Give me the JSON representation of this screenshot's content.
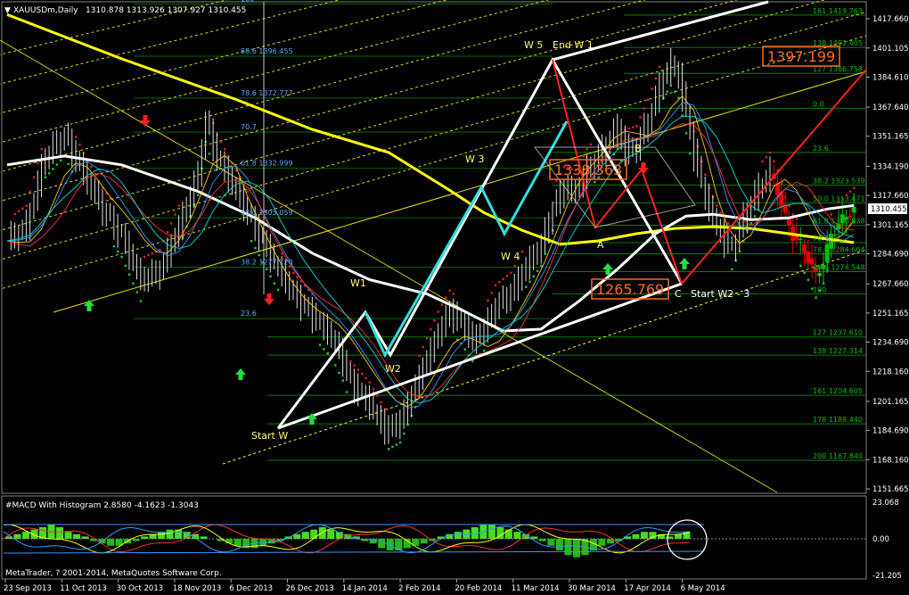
{
  "header": {
    "symbol": "XAUUSDm,Daily",
    "ohlc": "1310.878 1313.926 1307.927 1310.455"
  },
  "colors": {
    "background": "#000000",
    "bull_candle": "#00c000",
    "bear_candle": "#e00000",
    "ma_yellow": "#ffff00",
    "ma_white": "#ffffff",
    "fib_lines": "#008000",
    "fib_text": "#00c000",
    "channel": "#ffff00",
    "wave_cyan": "#33dddd",
    "red_projection": "#ff2020",
    "callout": "#ff6a1a"
  },
  "chart_data": [
    {
      "type": "line",
      "title": "",
      "xlabel": "",
      "ylabel": "",
      "x_ticks": [
        "23 Sep 2013",
        "11 Oct 2013",
        "30 Oct 2013",
        "18 Nov 2013",
        "6 Dec 2013",
        "26 Dec 2013",
        "14 Jan 2014",
        "2 Feb 2014",
        "20 Feb 2014",
        "11 Mar 2014",
        "30 Mar 2014",
        "17 Apr 2014",
        "6 May 2014"
      ],
      "y_ticks": [
        "1417.660",
        "1401.105",
        "1384.610",
        "1367.640",
        "1351.165",
        "1334.190",
        "1317.660",
        "1301.165",
        "1284.690",
        "1267.660",
        "1251.165",
        "1234.690",
        "1218.160",
        "1201.165",
        "1184.690",
        "1168.160",
        "1151.665"
      ],
      "ylim": [
        1151.665,
        1426
      ],
      "current_price": "1310.455",
      "price_path": [
        [
          0,
          1292
        ],
        [
          5,
          1300
        ],
        [
          10,
          1340
        ],
        [
          15,
          1352
        ],
        [
          20,
          1330
        ],
        [
          25,
          1310
        ],
        [
          30,
          1295
        ],
        [
          35,
          1270
        ],
        [
          40,
          1275
        ],
        [
          45,
          1300
        ],
        [
          50,
          1330
        ],
        [
          52,
          1360
        ],
        [
          55,
          1340
        ],
        [
          60,
          1320
        ],
        [
          65,
          1300
        ],
        [
          70,
          1280
        ],
        [
          75,
          1262
        ],
        [
          80,
          1250
        ],
        [
          85,
          1238
        ],
        [
          88,
          1225
        ],
        [
          90,
          1212
        ],
        [
          95,
          1200
        ],
        [
          99,
          1185
        ],
        [
          103,
          1190
        ],
        [
          107,
          1210
        ],
        [
          110,
          1225
        ],
        [
          113,
          1240
        ],
        [
          116,
          1252
        ],
        [
          119,
          1246
        ],
        [
          122,
          1236
        ],
        [
          125,
          1242
        ],
        [
          128,
          1255
        ],
        [
          132,
          1262
        ],
        [
          136,
          1278
        ],
        [
          140,
          1290
        ],
        [
          143,
          1310
        ],
        [
          146,
          1322
        ],
        [
          149,
          1320
        ],
        [
          152,
          1332
        ],
        [
          155,
          1340
        ],
        [
          158,
          1350
        ],
        [
          160,
          1356
        ],
        [
          162,
          1343
        ],
        [
          165,
          1345
        ],
        [
          168,
          1360
        ],
        [
          170,
          1372
        ],
        [
          172,
          1385
        ],
        [
          174,
          1392
        ],
        [
          176,
          1385
        ],
        [
          178,
          1365
        ],
        [
          180,
          1342
        ],
        [
          182,
          1325
        ],
        [
          184,
          1310
        ],
        [
          186,
          1300
        ],
        [
          188,
          1292
        ],
        [
          190,
          1288
        ],
        [
          192,
          1298
        ],
        [
          194,
          1310
        ],
        [
          196,
          1318
        ],
        [
          198,
          1325
        ],
        [
          200,
          1330
        ],
        [
          202,
          1320
        ],
        [
          204,
          1305
        ],
        [
          206,
          1295
        ],
        [
          208,
          1290
        ],
        [
          210,
          1282
        ],
        [
          212,
          1272
        ],
        [
          214,
          1280
        ],
        [
          216,
          1295
        ],
        [
          218,
          1302
        ],
        [
          220,
          1306
        ],
        [
          222,
          1310
        ]
      ],
      "series": [
        {
          "name": "",
          "color": "#ffff00",
          "values": [
            [
              0,
              1420
            ],
            [
              30,
              1395
            ],
            [
              60,
              1372
            ],
            [
              80,
              1355
            ],
            [
              100,
              1342
            ],
            [
              115,
              1322
            ],
            [
              125,
              1308
            ],
            [
              135,
              1298
            ],
            [
              145,
              1290
            ],
            [
              155,
              1292
            ],
            [
              165,
              1296
            ],
            [
              175,
              1299
            ],
            [
              185,
              1300
            ],
            [
              195,
              1299
            ],
            [
              205,
              1296
            ],
            [
              215,
              1293
            ],
            [
              222,
              1291
            ]
          ]
        },
        {
          "name": "",
          "color": "#ffffff",
          "values": [
            [
              0,
              1335
            ],
            [
              15,
              1340
            ],
            [
              30,
              1335
            ],
            [
              50,
              1320
            ],
            [
              65,
              1305
            ],
            [
              80,
              1285
            ],
            [
              95,
              1270
            ],
            [
              110,
              1262
            ],
            [
              120,
              1252
            ],
            [
              130,
              1241
            ],
            [
              140,
              1242
            ],
            [
              150,
              1258
            ],
            [
              160,
              1276
            ],
            [
              170,
              1296
            ],
            [
              178,
              1306
            ],
            [
              185,
              1307
            ],
            [
              195,
              1304
            ],
            [
              205,
              1305
            ],
            [
              215,
              1310
            ],
            [
              222,
              1312
            ]
          ]
        }
      ],
      "fibonacci_upper": [
        {
          "level": "161",
          "price": "1419.763"
        },
        {
          "level": "138",
          "price": "1401.405"
        },
        {
          "level": "127",
          "price": "1386.758"
        },
        {
          "level": "0.0",
          "price": ""
        },
        {
          "level": "23.6",
          "price": ""
        },
        {
          "level": "38.2",
          "price": "1323.539"
        },
        {
          "level": "50.0",
          "price": "1313.471"
        },
        {
          "level": "61.8",
          "price": "1300.838"
        },
        {
          "level": "70.7",
          "price": ""
        },
        {
          "level": "78.6",
          "price": "1284.664"
        },
        {
          "level": "88.6",
          "price": "1274.548"
        },
        {
          "level": "100",
          "price": ""
        },
        {
          "level": "127",
          "price": "1237.610"
        },
        {
          "level": "138",
          "price": "1227.314"
        },
        {
          "level": "161",
          "price": "1204.605"
        },
        {
          "level": "178",
          "price": "1188.440"
        },
        {
          "level": "200",
          "price": "1167.840"
        }
      ],
      "fibonacci_left": [
        {
          "level": "100",
          "price": ""
        },
        {
          "level": "88.6",
          "price": "1396.455"
        },
        {
          "level": "78.6",
          "price": "1372.777"
        },
        {
          "level": "70.7",
          "price": ""
        },
        {
          "level": "61.8",
          "price": "1332.999"
        },
        {
          "level": "50.0",
          "price": "1305.059"
        },
        {
          "level": "38.2",
          "price": "1277.120"
        },
        {
          "level": "23.6",
          "price": ""
        }
      ],
      "wave_labels": [
        "W 5",
        "End W 1",
        "W 3",
        "W 4",
        "W1",
        "W2",
        "Start W",
        "A",
        "B",
        "C",
        "Start W2 - 3"
      ],
      "callouts": [
        "1397.199",
        "1338.363",
        "1265.769"
      ]
    },
    {
      "type": "bar",
      "title": "#MACD With Histogram 2.8580 -4.1623 -1.3043",
      "y_ticks": [
        "23.068",
        "0.00",
        "-21.205"
      ],
      "ylim": [
        -21.205,
        23.068
      ],
      "histogram": [
        1,
        2,
        3,
        4,
        5,
        6,
        5,
        3,
        2,
        1,
        -1,
        -2,
        -3,
        -3,
        -2,
        -1,
        1,
        2,
        3,
        4,
        4,
        3,
        2,
        1,
        0,
        -1,
        -2,
        -3,
        -4,
        -4,
        -3,
        -2,
        -1,
        1,
        2,
        3,
        4,
        5,
        4,
        3,
        2,
        1,
        -1,
        -2,
        -4,
        -5,
        -5,
        -4,
        -3,
        -2,
        -1,
        1,
        2,
        3,
        4,
        5,
        6,
        6,
        5,
        4,
        3,
        2,
        1,
        -1,
        -3,
        -5,
        -7,
        -8,
        -7,
        -5,
        -3,
        -2,
        -1,
        1,
        2,
        3,
        3,
        2,
        1,
        2,
        3
      ],
      "footer": "MetaTrader, ? 2001-2014, MetaQuotes Software Corp."
    }
  ]
}
